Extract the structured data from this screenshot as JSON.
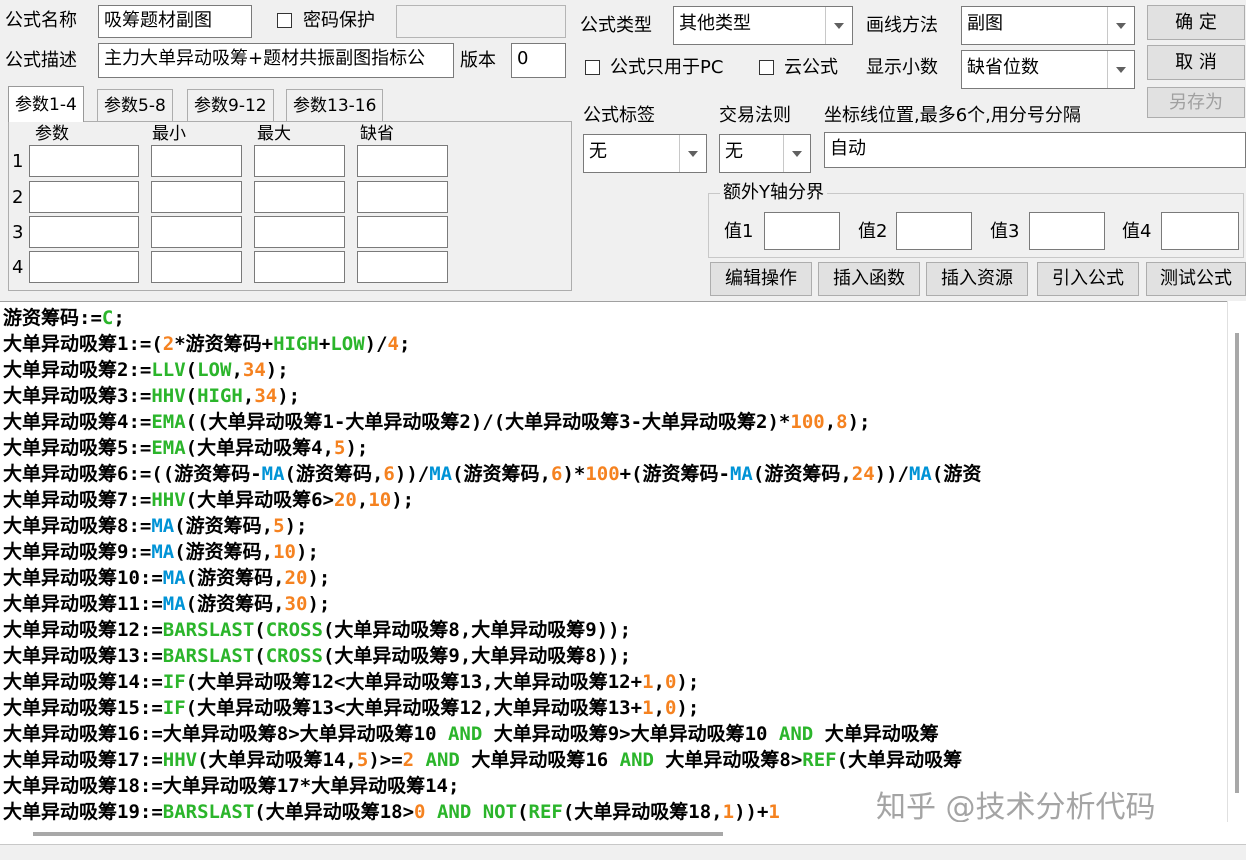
{
  "form": {
    "name_label": "公式名称",
    "name_value": "吸筹题材副图",
    "password_label": "密码保护",
    "password_value": "",
    "desc_label": "公式描述",
    "desc_value": "主力大单异动吸筹+题材共振副图指标公",
    "version_label": "版本",
    "version_value": "0",
    "type_label": "公式类型",
    "type_value": "其他类型",
    "draw_label": "画线方法",
    "draw_value": "副图",
    "pc_only_label": "公式只用于PC",
    "cloud_label": "云公式",
    "decimal_label": "显示小数",
    "decimal_value": "缺省位数",
    "tag_label": "公式标签",
    "tag_value": "无",
    "rule_label": "交易法则",
    "rule_value": "无",
    "axis_label": "坐标线位置,最多6个,用分号分隔",
    "axis_value": "自动",
    "extra_y_label": "额外Y轴分界",
    "val1_label": "值1",
    "val2_label": "值2",
    "val3_label": "值3",
    "val4_label": "值4"
  },
  "buttons": {
    "ok": "确 定",
    "cancel": "取 消",
    "save_as": "另存为",
    "edit_ops": "编辑操作",
    "insert_func": "插入函数",
    "insert_res": "插入资源",
    "import_formula": "引入公式",
    "test_formula": "测试公式"
  },
  "tabs": [
    "参数1-4",
    "参数5-8",
    "参数9-12",
    "参数13-16"
  ],
  "params": {
    "headers": [
      "参数",
      "最小",
      "最大",
      "缺省"
    ],
    "rows": [
      "1",
      "2",
      "3",
      "4"
    ]
  },
  "code_lines": [
    [
      [
        "游资筹码:=",
        "t"
      ],
      [
        "C",
        "k"
      ],
      [
        ";",
        "t"
      ]
    ],
    [
      [
        "大单异动吸筹1:=(",
        "t"
      ],
      [
        "2",
        "n"
      ],
      [
        "*游资筹码+",
        "t"
      ],
      [
        "HIGH",
        "k"
      ],
      [
        "+",
        "t"
      ],
      [
        "LOW",
        "k"
      ],
      [
        ")/",
        "t"
      ],
      [
        "4",
        "n"
      ],
      [
        ";",
        "t"
      ]
    ],
    [
      [
        "大单异动吸筹2:=",
        "t"
      ],
      [
        "LLV",
        "k"
      ],
      [
        "(",
        "t"
      ],
      [
        "LOW",
        "k"
      ],
      [
        ",",
        "t"
      ],
      [
        "34",
        "n"
      ],
      [
        ");",
        "t"
      ]
    ],
    [
      [
        "大单异动吸筹3:=",
        "t"
      ],
      [
        "HHV",
        "k"
      ],
      [
        "(",
        "t"
      ],
      [
        "HIGH",
        "k"
      ],
      [
        ",",
        "t"
      ],
      [
        "34",
        "n"
      ],
      [
        ");",
        "t"
      ]
    ],
    [
      [
        "大单异动吸筹4:=",
        "t"
      ],
      [
        "EMA",
        "k"
      ],
      [
        "((大单异动吸筹1-大单异动吸筹2)/(大单异动吸筹3-大单异动吸筹2)*",
        "t"
      ],
      [
        "100",
        "n"
      ],
      [
        ",",
        "t"
      ],
      [
        "8",
        "n"
      ],
      [
        ");",
        "t"
      ]
    ],
    [
      [
        "大单异动吸筹5:=",
        "t"
      ],
      [
        "EMA",
        "k"
      ],
      [
        "(大单异动吸筹4,",
        "t"
      ],
      [
        "5",
        "n"
      ],
      [
        ");",
        "t"
      ]
    ],
    [
      [
        "大单异动吸筹6:=((游资筹码-",
        "t"
      ],
      [
        "MA",
        "f"
      ],
      [
        "(游资筹码,",
        "t"
      ],
      [
        "6",
        "n"
      ],
      [
        "))/",
        "t"
      ],
      [
        "MA",
        "f"
      ],
      [
        "(游资筹码,",
        "t"
      ],
      [
        "6",
        "n"
      ],
      [
        ")*",
        "t"
      ],
      [
        "100",
        "n"
      ],
      [
        "+(游资筹码-",
        "t"
      ],
      [
        "MA",
        "f"
      ],
      [
        "(游资筹码,",
        "t"
      ],
      [
        "24",
        "n"
      ],
      [
        "))/",
        "t"
      ],
      [
        "MA",
        "f"
      ],
      [
        "(游资",
        "t"
      ]
    ],
    [
      [
        "大单异动吸筹7:=",
        "t"
      ],
      [
        "HHV",
        "k"
      ],
      [
        "(大单异动吸筹6>",
        "t"
      ],
      [
        "20",
        "n"
      ],
      [
        ",",
        "t"
      ],
      [
        "10",
        "n"
      ],
      [
        ");",
        "t"
      ]
    ],
    [
      [
        "大单异动吸筹8:=",
        "t"
      ],
      [
        "MA",
        "f"
      ],
      [
        "(游资筹码,",
        "t"
      ],
      [
        "5",
        "n"
      ],
      [
        ");",
        "t"
      ]
    ],
    [
      [
        "大单异动吸筹9:=",
        "t"
      ],
      [
        "MA",
        "f"
      ],
      [
        "(游资筹码,",
        "t"
      ],
      [
        "10",
        "n"
      ],
      [
        ");",
        "t"
      ]
    ],
    [
      [
        "大单异动吸筹10:=",
        "t"
      ],
      [
        "MA",
        "f"
      ],
      [
        "(游资筹码,",
        "t"
      ],
      [
        "20",
        "n"
      ],
      [
        ");",
        "t"
      ]
    ],
    [
      [
        "大单异动吸筹11:=",
        "t"
      ],
      [
        "MA",
        "f"
      ],
      [
        "(游资筹码,",
        "t"
      ],
      [
        "30",
        "n"
      ],
      [
        ");",
        "t"
      ]
    ],
    [
      [
        "大单异动吸筹12:=",
        "t"
      ],
      [
        "BARSLAST",
        "k"
      ],
      [
        "(",
        "t"
      ],
      [
        "CROSS",
        "k"
      ],
      [
        "(大单异动吸筹8,大单异动吸筹9));",
        "t"
      ]
    ],
    [
      [
        "大单异动吸筹13:=",
        "t"
      ],
      [
        "BARSLAST",
        "k"
      ],
      [
        "(",
        "t"
      ],
      [
        "CROSS",
        "k"
      ],
      [
        "(大单异动吸筹9,大单异动吸筹8));",
        "t"
      ]
    ],
    [
      [
        "大单异动吸筹14:=",
        "t"
      ],
      [
        "IF",
        "k"
      ],
      [
        "(大单异动吸筹12<大单异动吸筹13,大单异动吸筹12+",
        "t"
      ],
      [
        "1",
        "n"
      ],
      [
        ",",
        "t"
      ],
      [
        "0",
        "n"
      ],
      [
        ");",
        "t"
      ]
    ],
    [
      [
        "大单异动吸筹15:=",
        "t"
      ],
      [
        "IF",
        "k"
      ],
      [
        "(大单异动吸筹13<大单异动吸筹12,大单异动吸筹13+",
        "t"
      ],
      [
        "1",
        "n"
      ],
      [
        ",",
        "t"
      ],
      [
        "0",
        "n"
      ],
      [
        ");",
        "t"
      ]
    ],
    [
      [
        "大单异动吸筹16:=大单异动吸筹8>大单异动吸筹10 ",
        "t"
      ],
      [
        "AND",
        "k"
      ],
      [
        " 大单异动吸筹9>大单异动吸筹10 ",
        "t"
      ],
      [
        "AND",
        "k"
      ],
      [
        " 大单异动吸筹",
        "t"
      ]
    ],
    [
      [
        "大单异动吸筹17:=",
        "t"
      ],
      [
        "HHV",
        "k"
      ],
      [
        "(大单异动吸筹14,",
        "t"
      ],
      [
        "5",
        "n"
      ],
      [
        ")>=",
        "t"
      ],
      [
        "2",
        "n"
      ],
      [
        " ",
        "t"
      ],
      [
        "AND",
        "k"
      ],
      [
        " 大单异动吸筹16 ",
        "t"
      ],
      [
        "AND",
        "k"
      ],
      [
        " 大单异动吸筹8>",
        "t"
      ],
      [
        "REF",
        "k"
      ],
      [
        "(大单异动吸筹",
        "t"
      ]
    ],
    [
      [
        "大单异动吸筹18:=大单异动吸筹17*大单异动吸筹14;",
        "t"
      ]
    ],
    [
      [
        "大单异动吸筹19:=",
        "t"
      ],
      [
        "BARSLAST",
        "k"
      ],
      [
        "(大单异动吸筹18>",
        "t"
      ],
      [
        "0",
        "n"
      ],
      [
        " ",
        "t"
      ],
      [
        "AND",
        "k"
      ],
      [
        " ",
        "t"
      ],
      [
        "NOT",
        "k"
      ],
      [
        "(",
        "t"
      ],
      [
        "REF",
        "k"
      ],
      [
        "(大单异动吸筹18,",
        "t"
      ],
      [
        "1",
        "n"
      ],
      [
        "))+",
        "t"
      ],
      [
        "1",
        "n"
      ]
    ]
  ],
  "watermark": "知乎 @技术分析代码",
  "colors": {
    "number": "#f58220",
    "function": "#0093d6",
    "keyword": "#2bb52b"
  }
}
